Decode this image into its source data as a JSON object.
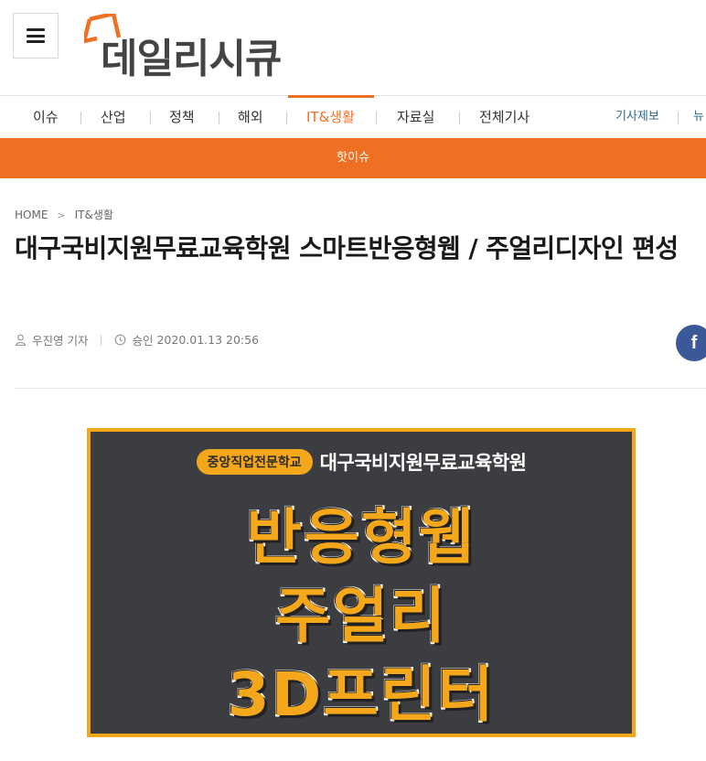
{
  "header": {
    "menu_icon": "hamburger-menu-icon",
    "logo_text": "데일리시큐",
    "logo_accent": "#f07023"
  },
  "nav": {
    "items": [
      {
        "label": "이슈"
      },
      {
        "label": "산업"
      },
      {
        "label": "정책"
      },
      {
        "label": "해외"
      },
      {
        "label": "IT&생활",
        "active": true
      },
      {
        "label": "자료실"
      },
      {
        "label": "전체기사"
      }
    ],
    "right_links": [
      "기사제보",
      "뉴"
    ]
  },
  "hot_issue": {
    "label": "핫이슈"
  },
  "breadcrumb": {
    "home": "HOME",
    "section": "IT&생활"
  },
  "article": {
    "title": "대구국비지원무료교육학원 스마트반응형웹 / 주얼리디자인 편성",
    "author": "우진영 기자",
    "approved_label": "승인",
    "approved_time": "2020.01.13 20:56",
    "share_icon": "facebook-icon"
  },
  "banner": {
    "school": "중앙직업전문학교",
    "academy": "대구국비지원무료교육학원",
    "line1": "반응형웹",
    "line2": "주얼리",
    "line3": "3D프린터"
  },
  "colors": {
    "accent": "#f07023",
    "banner_border": "#f5a71b",
    "banner_bg": "#3c3d41"
  }
}
